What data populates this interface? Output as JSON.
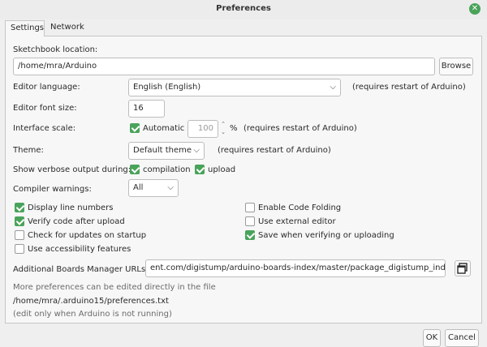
{
  "window": {
    "title": "Preferences"
  },
  "tabs": [
    {
      "label": "Settings"
    },
    {
      "label": "Network"
    }
  ],
  "sketchbook": {
    "label": "Sketchbook location:",
    "value": "/home/mra/Arduino",
    "browse": "Browse"
  },
  "editor_language": {
    "label": "Editor language:",
    "value": "English (English)",
    "note": "(requires restart of Arduino)"
  },
  "font_size": {
    "label": "Editor font size:",
    "value": "16"
  },
  "interface_scale": {
    "label": "Interface scale:",
    "automatic": "Automatic",
    "value": "100",
    "unit": "%",
    "note": "(requires restart of Arduino)"
  },
  "theme": {
    "label": "Theme:",
    "value": "Default theme",
    "note": "(requires restart of Arduino)"
  },
  "verbose": {
    "label": "Show verbose output during:",
    "compilation": "compilation",
    "upload": "upload"
  },
  "warnings": {
    "label": "Compiler warnings:",
    "value": "All"
  },
  "options_left": [
    {
      "label": "Display line numbers",
      "checked": true
    },
    {
      "label": "Verify code after upload",
      "checked": true
    },
    {
      "label": "Check for updates on startup",
      "checked": false
    },
    {
      "label": "Use accessibility features",
      "checked": false
    }
  ],
  "options_right": [
    {
      "label": "Enable Code Folding",
      "checked": false
    },
    {
      "label": "Use external editor",
      "checked": false
    },
    {
      "label": "Save when verifying or uploading",
      "checked": true
    }
  ],
  "boards": {
    "label": "Additional Boards Manager URLs:",
    "value": "ent.com/digistump/arduino-boards-index/master/package_digistump_index.json"
  },
  "footer": {
    "more": "More preferences can be edited directly in the file",
    "path": "/home/mra/.arduino15/preferences.txt",
    "hint": "(edit only when Arduino is not running)"
  },
  "buttons": {
    "ok": "OK",
    "cancel": "Cancel"
  },
  "colors": {
    "accent": "#49a35a"
  }
}
